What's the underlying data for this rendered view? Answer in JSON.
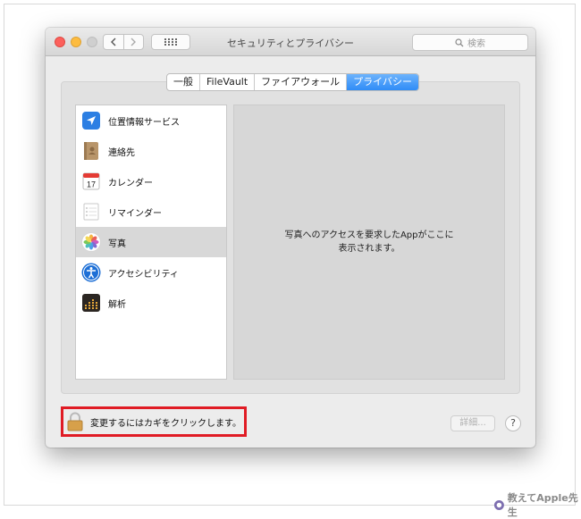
{
  "window": {
    "title": "セキュリティとプライバシー",
    "search_placeholder": "検索"
  },
  "tabs": [
    {
      "label": "一般",
      "active": false
    },
    {
      "label": "FileVault",
      "active": false
    },
    {
      "label": "ファイアウォール",
      "active": false
    },
    {
      "label": "プライバシー",
      "active": true
    }
  ],
  "privacy_list": [
    {
      "label": "位置情報サービス",
      "icon": "location-arrow-icon",
      "selected": false
    },
    {
      "label": "連絡先",
      "icon": "contacts-book-icon",
      "selected": false
    },
    {
      "label": "カレンダー",
      "icon": "calendar-icon",
      "selected": false
    },
    {
      "label": "リマインダー",
      "icon": "reminders-icon",
      "selected": false
    },
    {
      "label": "写真",
      "icon": "photos-flower-icon",
      "selected": true
    },
    {
      "label": "アクセシビリティ",
      "icon": "accessibility-icon",
      "selected": false
    },
    {
      "label": "解析",
      "icon": "analytics-icon",
      "selected": false
    }
  ],
  "calendar_day": "17",
  "detail_message": "写真へのアクセスを要求したAppがここに表示されます。",
  "footer": {
    "lock_label": "変更するにはカギをクリックします。",
    "advanced_button": "詳細...",
    "help_button": "?"
  },
  "watermark": "教えてApple先生",
  "colors": {
    "accent": "#2f8cf7",
    "highlight_border": "#e01b24",
    "close": "#fc605c",
    "minimize": "#fdbc40"
  }
}
